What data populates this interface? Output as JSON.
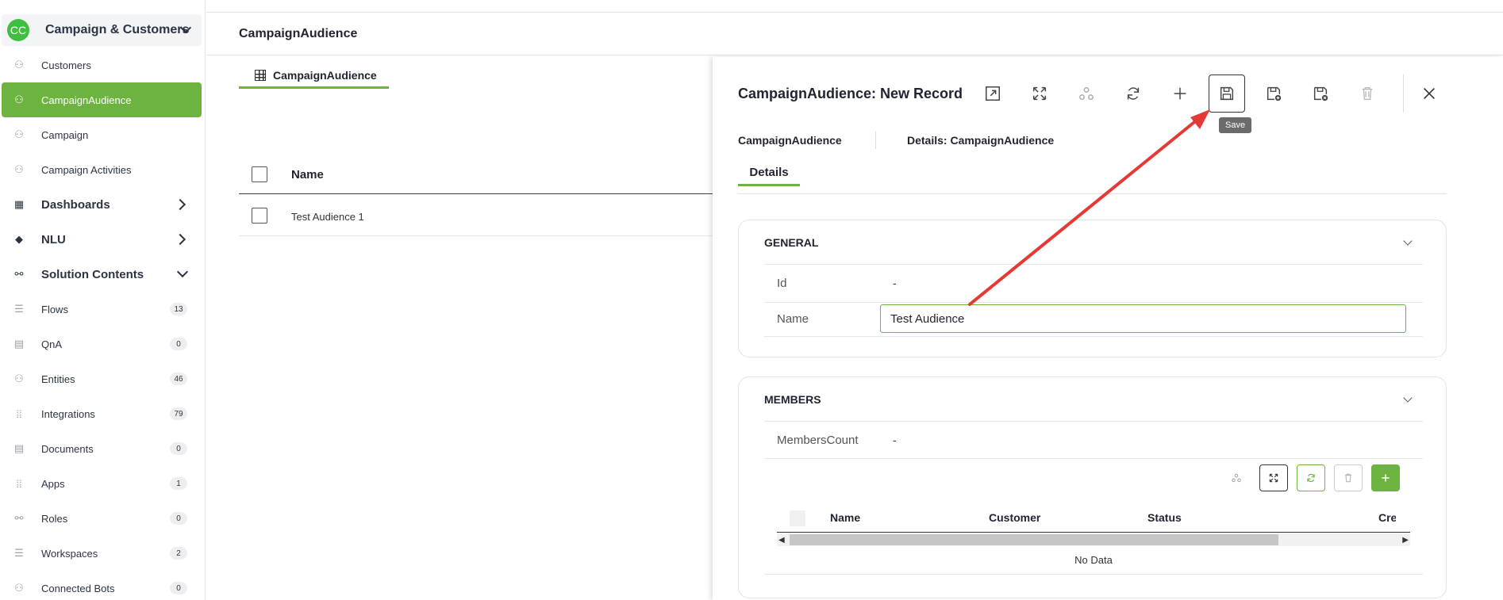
{
  "workspace": {
    "initials": "CC",
    "title": "Campaign & Customers"
  },
  "sidebar": {
    "items": [
      {
        "label": "Customers"
      },
      {
        "label": "CampaignAudience"
      },
      {
        "label": "Campaign"
      },
      {
        "label": "Campaign Activities"
      }
    ],
    "sections": [
      {
        "label": "Dashboards"
      },
      {
        "label": "NLU"
      },
      {
        "label": "Solution Contents"
      }
    ],
    "contents": [
      {
        "label": "Flows",
        "count": "13"
      },
      {
        "label": "QnA",
        "count": "0"
      },
      {
        "label": "Entities",
        "count": "46"
      },
      {
        "label": "Integrations",
        "count": "79"
      },
      {
        "label": "Documents",
        "count": "0"
      },
      {
        "label": "Apps",
        "count": "1"
      },
      {
        "label": "Roles",
        "count": "0"
      },
      {
        "label": "Workspaces",
        "count": "2"
      },
      {
        "label": "Connected Bots",
        "count": "0"
      }
    ]
  },
  "main": {
    "title": "CampaignAudience",
    "tab_label": "CampaignAudience",
    "list": {
      "column_name": "Name",
      "rows": [
        {
          "name": "Test Audience 1"
        }
      ]
    }
  },
  "panel": {
    "title": "CampaignAudience: New Record",
    "tooltip": "Save",
    "breadcrumb": {
      "entity": "CampaignAudience",
      "details": "Details: CampaignAudience"
    },
    "tab": "Details",
    "general": {
      "title": "GENERAL",
      "id_label": "Id",
      "id_value": "-",
      "name_label": "Name",
      "name_value": "Test Audience"
    },
    "members": {
      "title": "MEMBERS",
      "count_label": "MembersCount",
      "count_value": "-",
      "columns": [
        "Name",
        "Customer",
        "Status",
        "Creat"
      ],
      "empty_text": "No Data"
    }
  },
  "colors": {
    "accent": "#6db33f",
    "arrow": "#e53935"
  }
}
